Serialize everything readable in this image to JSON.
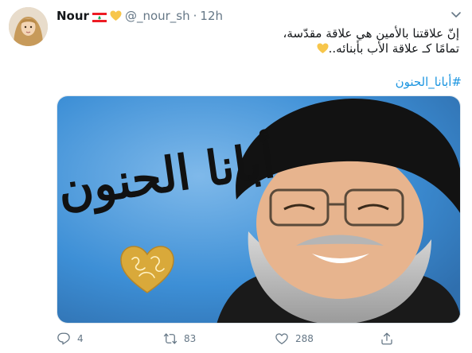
{
  "author": {
    "name": "Nour",
    "handle": "@_nour_sh",
    "separator": "·",
    "time": "12h",
    "flag_icon": "lebanon-flag-icon",
    "badge_icon": "yellow-heart-icon"
  },
  "tweet": {
    "line1": "إنّ علاقتنا بالأمين هي علاقة مقدّسة،",
    "line2": "تمامًا كـ علاقة الأب بأبنائه..",
    "hashtag": "#أبانا_الحنون",
    "line2_emoji": "yellow-heart-icon"
  },
  "media": {
    "caption": "أبانا الحنون",
    "ornament_icon": "gold-heart-icon"
  },
  "actions": {
    "reply_count": "4",
    "retweet_count": "83",
    "like_count": "288"
  },
  "colors": {
    "link": "#1b95e0",
    "muted": "#657786",
    "media_background": "#3d8fd6",
    "heart_yellow": "#f7c64b"
  }
}
